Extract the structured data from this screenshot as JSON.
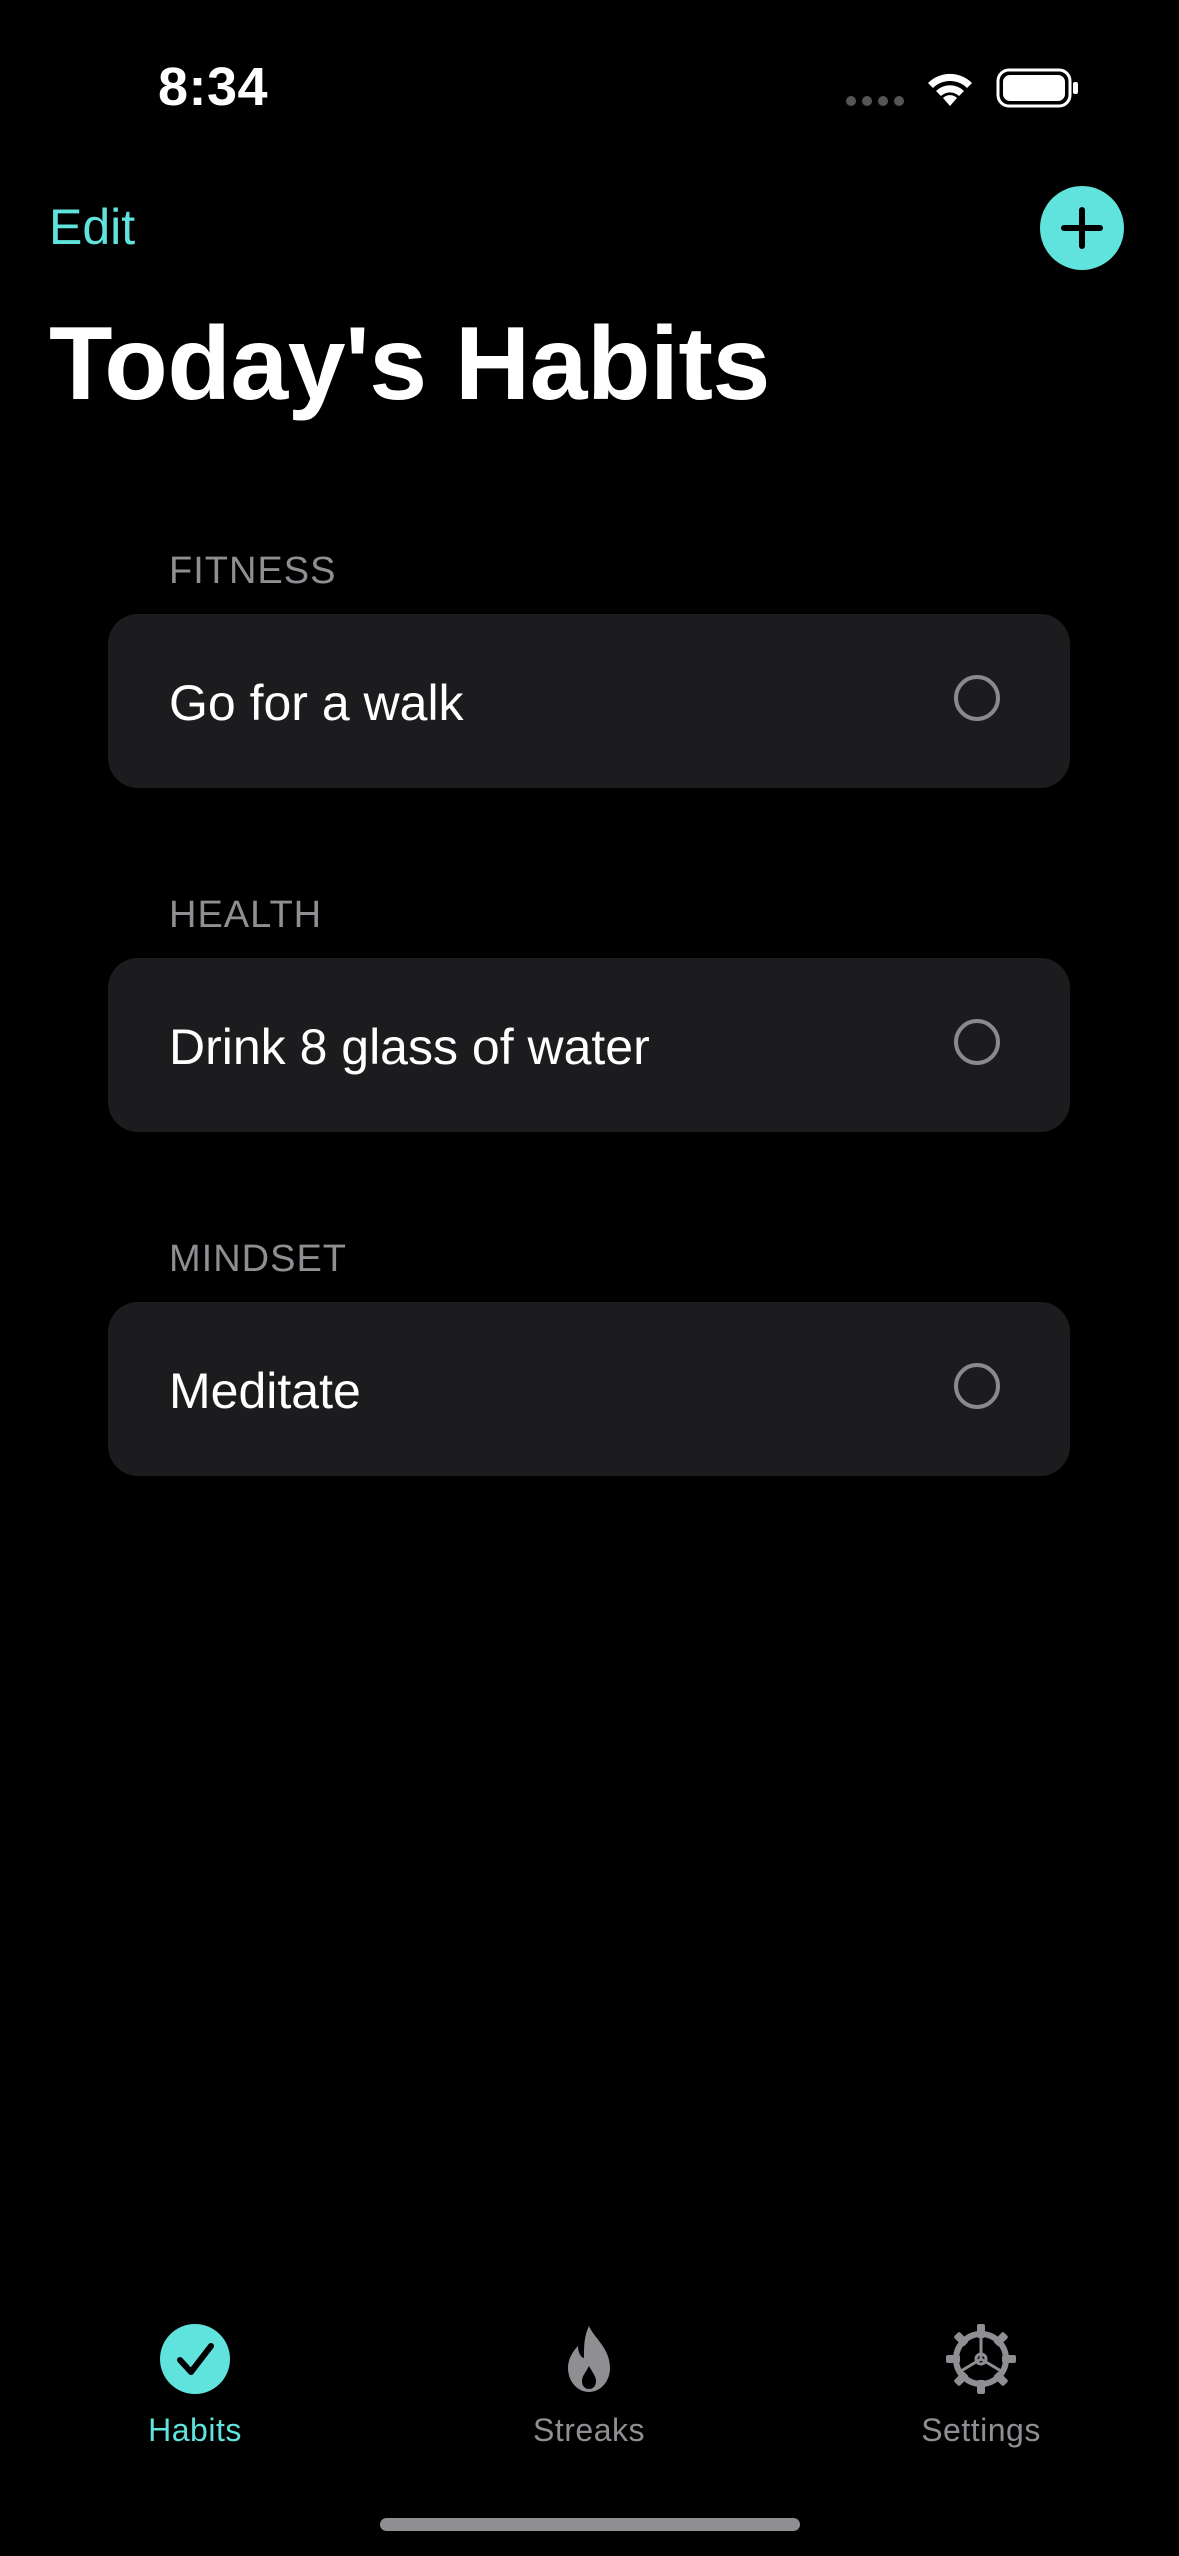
{
  "status_bar": {
    "time": "8:34"
  },
  "header": {
    "edit_label": "Edit",
    "title": "Today's Habits"
  },
  "sections": [
    {
      "label": "FITNESS",
      "habits": [
        {
          "name": "Go for a walk",
          "completed": false
        }
      ]
    },
    {
      "label": "HEALTH",
      "habits": [
        {
          "name": "Drink 8 glass of water",
          "completed": false
        }
      ]
    },
    {
      "label": "MINDSET",
      "habits": [
        {
          "name": "Meditate",
          "completed": false
        }
      ]
    }
  ],
  "tab_bar": {
    "tabs": [
      {
        "label": "Habits",
        "icon": "checkmark-circle-icon",
        "active": true
      },
      {
        "label": "Streaks",
        "icon": "flame-icon",
        "active": false
      },
      {
        "label": "Settings",
        "icon": "gear-icon",
        "active": false
      }
    ]
  },
  "colors": {
    "accent": "#5fe3dc",
    "background": "#000000",
    "card": "#1c1c1e",
    "secondary_text": "#8e8e93"
  }
}
